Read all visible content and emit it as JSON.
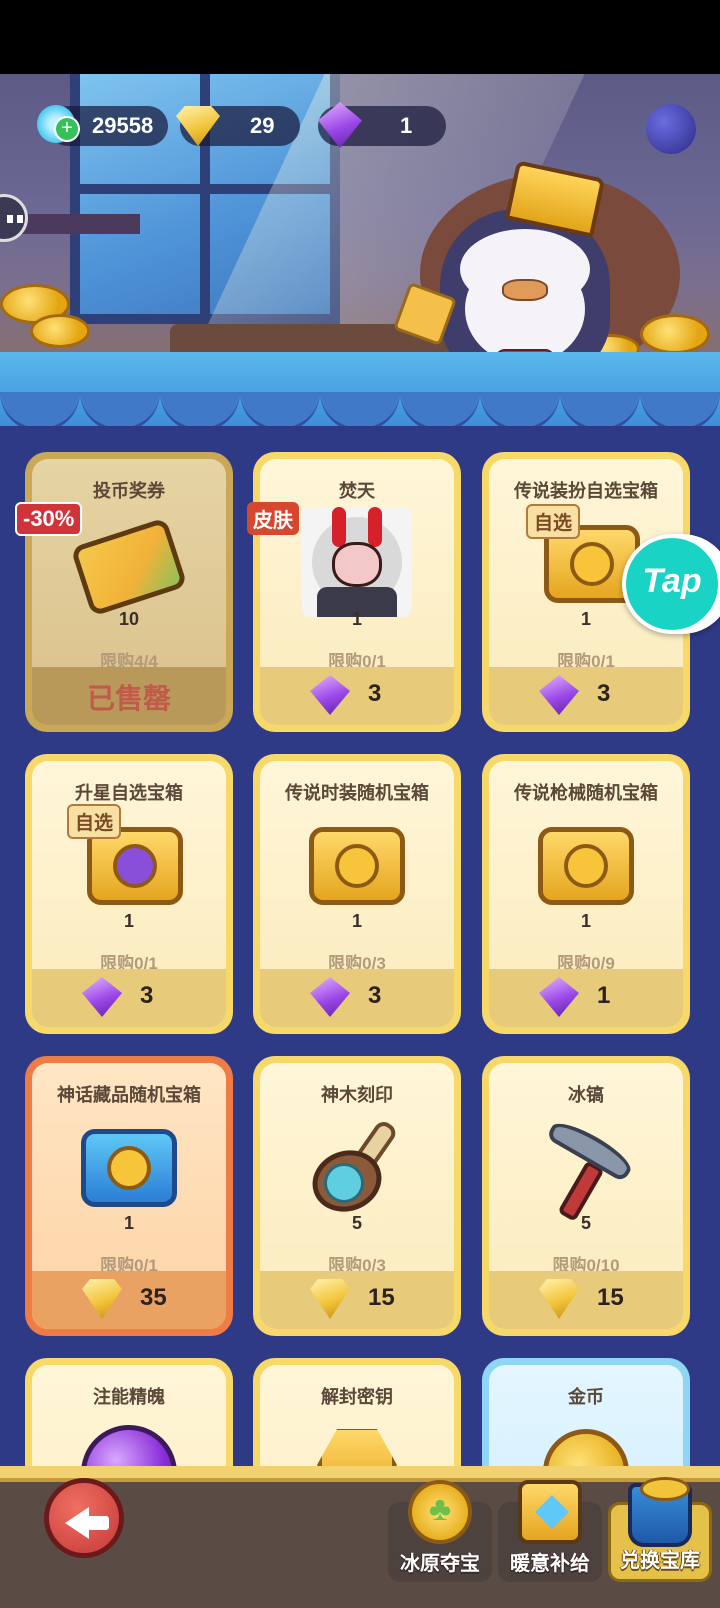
{
  "currency": {
    "crystals": "29558",
    "gold_gems": "29",
    "purple_gems": "1"
  },
  "shop": {
    "items": [
      {
        "title": "投币奖券",
        "qty": "10",
        "limit": "限购4/4",
        "tag": "-30%",
        "status": "已售罄",
        "price": "",
        "price_icon": "none",
        "art": "ticket"
      },
      {
        "title": "焚天",
        "qty": "1",
        "limit": "限购0/1",
        "tag": "皮肤",
        "price": "3",
        "price_icon": "purple-gem",
        "art": "portrait"
      },
      {
        "title": "传说装扮自选宝箱",
        "qty": "1",
        "limit": "限购0/1",
        "tag": "自选",
        "price": "3",
        "price_icon": "purple-gem",
        "art": "gold-chest"
      },
      {
        "title": "升星自选宝箱",
        "qty": "1",
        "limit": "限购0/1",
        "tag": "自选",
        "price": "3",
        "price_icon": "purple-gem",
        "art": "star-chest"
      },
      {
        "title": "传说时装随机宝箱",
        "qty": "1",
        "limit": "限购0/3",
        "tag": "",
        "price": "3",
        "price_icon": "purple-gem",
        "art": "gold-chest"
      },
      {
        "title": "传说枪械随机宝箱",
        "qty": "1",
        "limit": "限购0/9",
        "tag": "",
        "price": "1",
        "price_icon": "purple-gem",
        "art": "gold-chest"
      },
      {
        "title": "神话藏品随机宝箱",
        "qty": "1",
        "limit": "限购0/1",
        "tag": "",
        "price": "35",
        "price_icon": "gold-gem",
        "art": "blue-chest"
      },
      {
        "title": "神木刻印",
        "qty": "5",
        "limit": "限购0/3",
        "tag": "",
        "price": "15",
        "price_icon": "gold-gem",
        "art": "hammer"
      },
      {
        "title": "冰镐",
        "qty": "5",
        "limit": "限购0/10",
        "tag": "",
        "price": "15",
        "price_icon": "gold-gem",
        "art": "pickaxe"
      },
      {
        "title": "注能精魄",
        "art": "orb"
      },
      {
        "title": "解封密钥",
        "art": "key"
      },
      {
        "title": "金币",
        "art": "coin"
      }
    ]
  },
  "nav": {
    "tabs": [
      {
        "label": "冰原夺宝",
        "icon": "clover-coin-icon"
      },
      {
        "label": "暖意补给",
        "icon": "chest-icon"
      },
      {
        "label": "兑换宝库",
        "icon": "basket-icon",
        "active": true
      }
    ]
  },
  "tap": {
    "label": "Tap"
  }
}
